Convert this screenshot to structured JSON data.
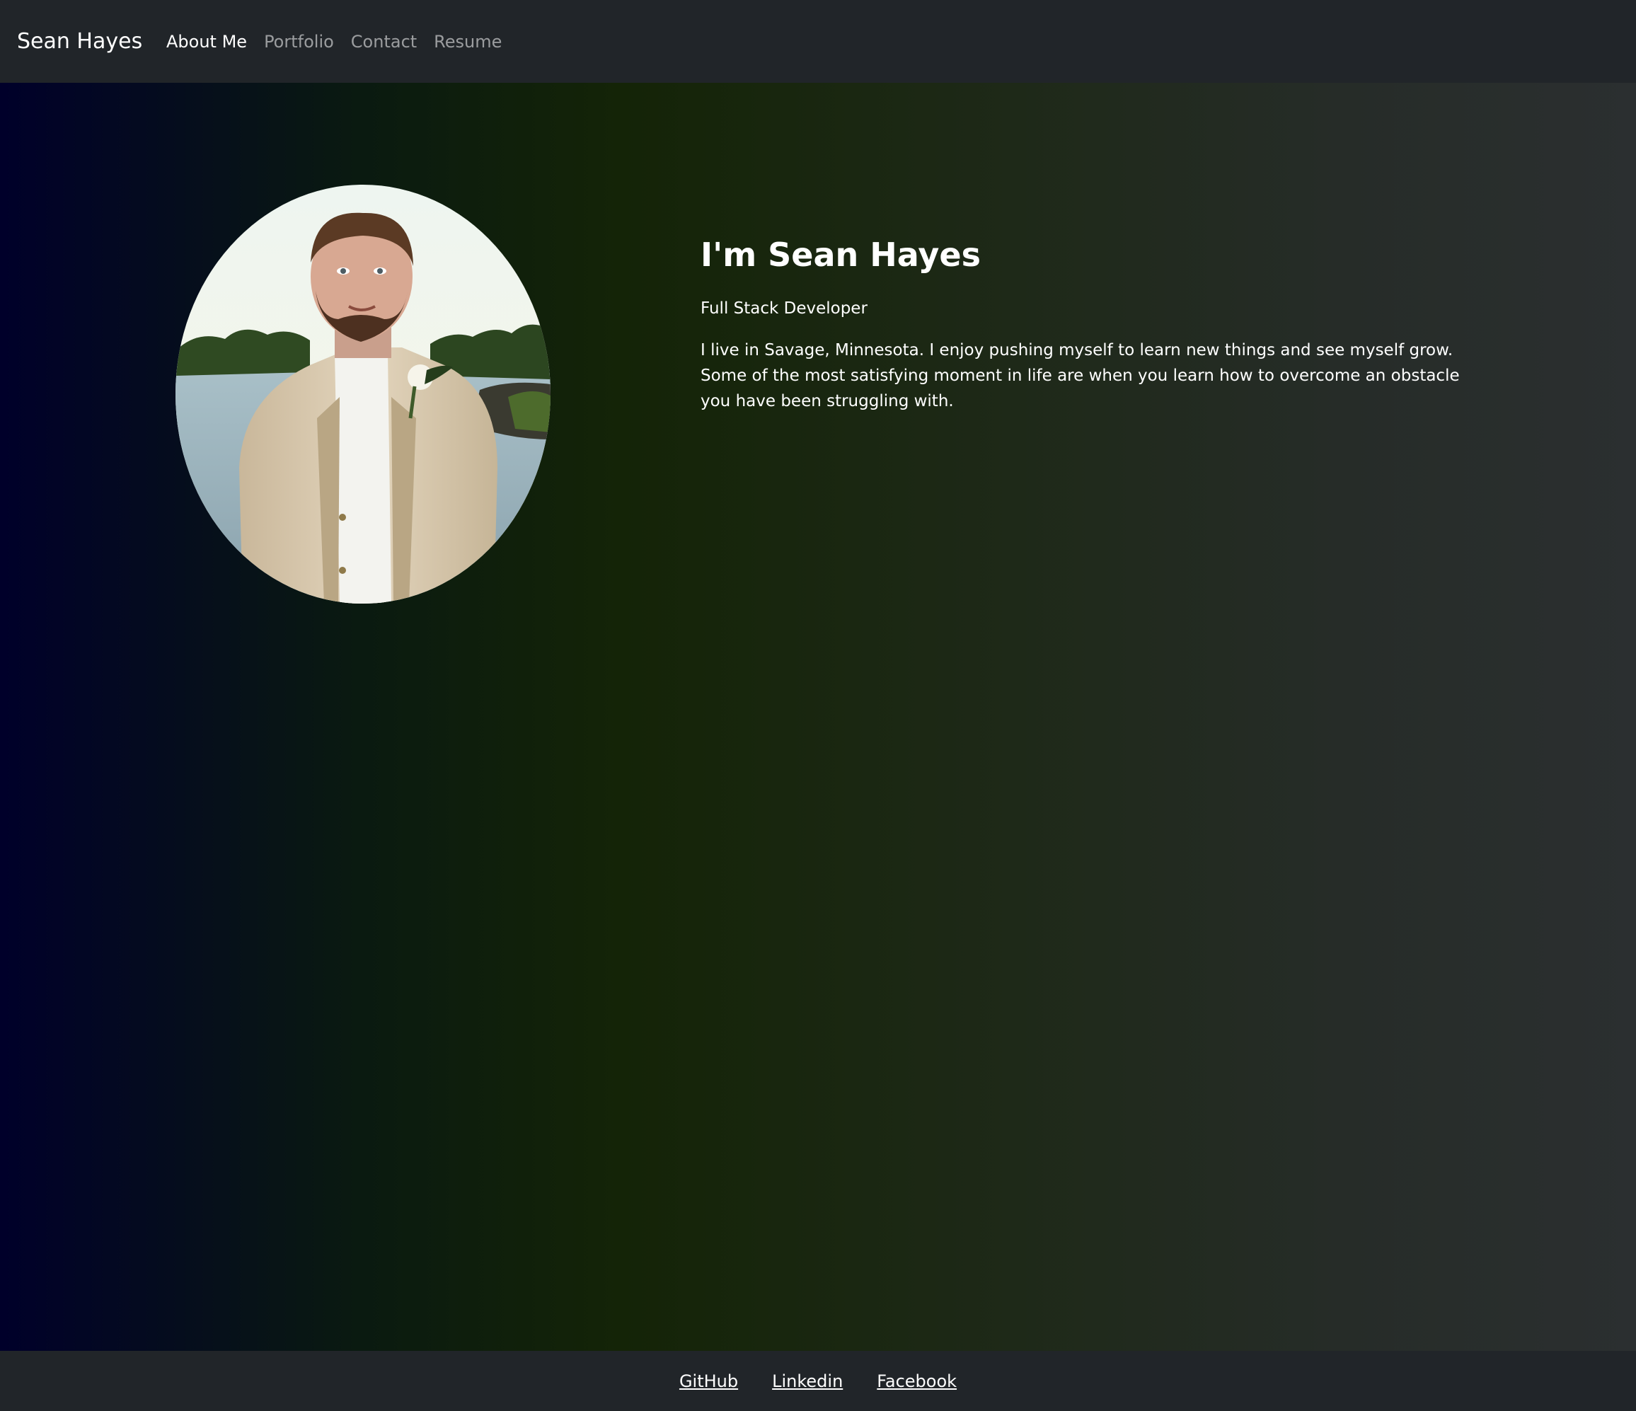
{
  "navbar": {
    "brand": "Sean Hayes",
    "items": [
      {
        "label": "About Me",
        "active": true
      },
      {
        "label": "Portfolio",
        "active": false
      },
      {
        "label": "Contact",
        "active": false
      },
      {
        "label": "Resume",
        "active": false
      }
    ]
  },
  "profile": {
    "heading": "I'm Sean Hayes",
    "role": "Full Stack Developer",
    "about": "I live in Savage, Minnesota. I enjoy pushing myself to learn new things and see myself grow. Some of the most satisfying moment in life are when you learn how to overcome an obstacle you have been struggling with."
  },
  "footer": {
    "links": [
      "GitHub",
      "Linkedin",
      "Facebook"
    ]
  },
  "colors": {
    "navbar_bg": "#212529",
    "nav_active": "#ffffff",
    "nav_inactive": "#8c8f93"
  }
}
